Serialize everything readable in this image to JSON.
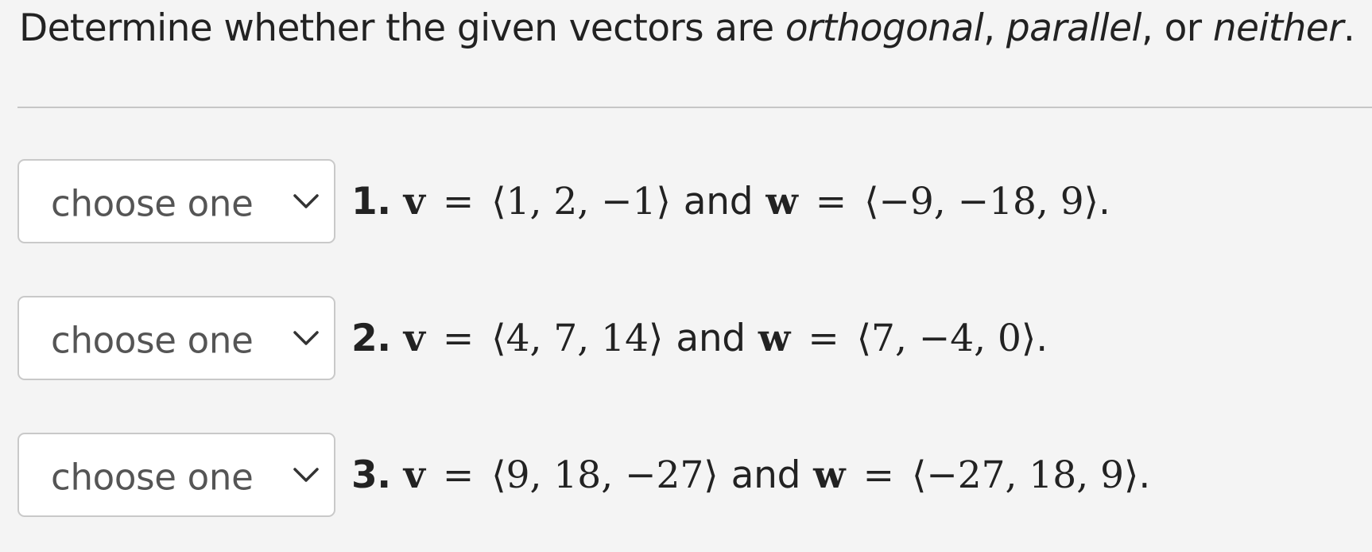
{
  "prompt": {
    "prefix": "Determine whether the given vectors are ",
    "opt1": "orthogonal",
    "sep1": ", ",
    "opt2": "parallel",
    "sep2": ", or ",
    "opt3": "neither",
    "suffix": "."
  },
  "questions": [
    {
      "number": "1.",
      "select_label": "choose one",
      "v_name": "v",
      "w_name": "w",
      "equals": "=",
      "connector": "and",
      "v_value": "⟨1, 2, −1⟩",
      "w_value": "⟨−9, −18, 9⟩",
      "end": "."
    },
    {
      "number": "2.",
      "select_label": "choose one",
      "v_name": "v",
      "w_name": "w",
      "equals": "=",
      "connector": "and",
      "v_value": "⟨4, 7, 14⟩",
      "w_value": "⟨7, −4, 0⟩",
      "end": "."
    },
    {
      "number": "3.",
      "select_label": "choose one",
      "v_name": "v",
      "w_name": "w",
      "equals": "=",
      "connector": "and",
      "v_value": "⟨9, 18, −27⟩",
      "w_value": "⟨−27, 18, 9⟩",
      "end": "."
    }
  ]
}
